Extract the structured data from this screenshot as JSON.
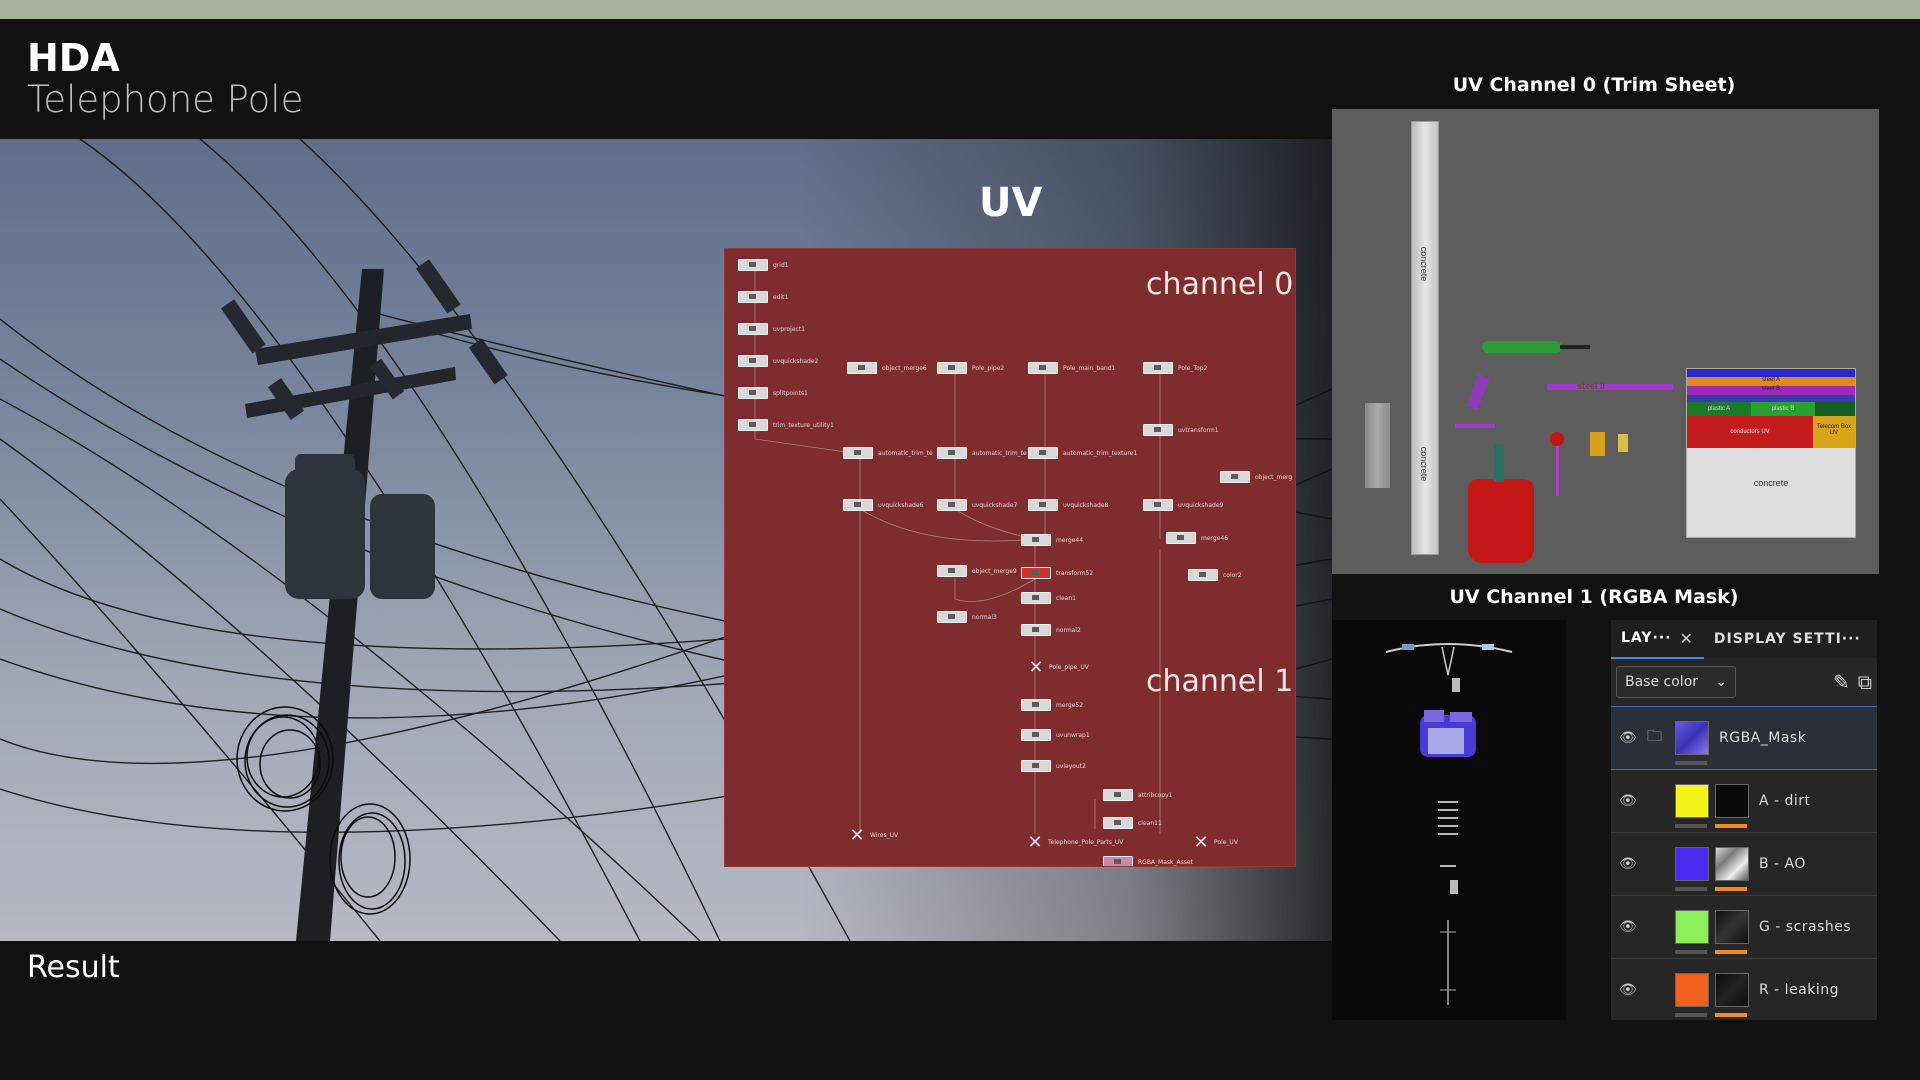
{
  "header": {
    "title": "HDA",
    "subtitle": "Telephone Pole"
  },
  "photo": {
    "caption": "Result"
  },
  "uv_section": {
    "heading": "UV",
    "channel0_label": "channel 0",
    "channel1_label": "channel 1",
    "nodes": [
      {
        "label": "grid1"
      },
      {
        "label": "edit1"
      },
      {
        "label": "uvproject1"
      },
      {
        "label": "uvquickshade2"
      },
      {
        "label": "splitpoints1"
      },
      {
        "label": "trim_texture_utility1"
      },
      {
        "label": "object_merge6"
      },
      {
        "label": "Pole_pipe2"
      },
      {
        "label": "Pole_main_band1"
      },
      {
        "label": "Pole_Top2"
      },
      {
        "label": "uvtransform1"
      },
      {
        "label": "object_merg"
      },
      {
        "label": "automatic_trim_te"
      },
      {
        "label": "automatic_trim_te"
      },
      {
        "label": "automatic_trim_texture1"
      },
      {
        "label": "uvquickshade6"
      },
      {
        "label": "uvquickshade7"
      },
      {
        "label": "uvquickshade8"
      },
      {
        "label": "uvquickshade9"
      },
      {
        "label": "merge44"
      },
      {
        "label": "merge46"
      },
      {
        "label": "object_merge9"
      },
      {
        "label": "transform52"
      },
      {
        "label": "color2"
      },
      {
        "label": "clean1"
      },
      {
        "label": "normal3"
      },
      {
        "label": "normal2"
      },
      {
        "label": "Pole_pipe_UV"
      },
      {
        "label": "merge52"
      },
      {
        "label": "uvunwrap1"
      },
      {
        "label": "uvlayout2"
      },
      {
        "label": "attribcopy1"
      },
      {
        "label": "clean11"
      },
      {
        "label": "Wires_UV"
      },
      {
        "label": "Telephone_Pole_Parts_UV"
      },
      {
        "label": "Pole_UV"
      },
      {
        "label": "RGBA_Mask_Asset"
      }
    ]
  },
  "trim_sheet": {
    "title": "UV Channel 0 (Trim Sheet)",
    "labels": {
      "concrete_top": "concrete",
      "concrete_bottom": "concrete",
      "steel_strip": "steel II",
      "steel_a": "steel A",
      "steel_b": "steel B",
      "plastic_a": "plastic A",
      "plastic_b": "plastic B",
      "conductors": "conductors UV",
      "telecom_box": "Telecom Box UV",
      "concrete_block": "concrete"
    }
  },
  "rgba_mask": {
    "title": "UV Channel 1 (RGBA Mask)"
  },
  "layers_panel": {
    "tabs": [
      {
        "label": "LAY···",
        "active": true
      },
      {
        "label": "DISPLAY SETTI···",
        "active": false
      }
    ],
    "channel_select": "Base color",
    "layers": [
      {
        "name": "RGBA_Mask",
        "color": "#5a4fd0",
        "is_folder": true,
        "selected": true
      },
      {
        "name": "A - dirt",
        "color": "#f5f51a",
        "is_folder": false,
        "selected": false
      },
      {
        "name": "B - AO",
        "color": "#4a2cf0",
        "is_folder": false,
        "selected": false
      },
      {
        "name": "G - scrashes",
        "color": "#8ef05a",
        "is_folder": false,
        "selected": false
      },
      {
        "name": "R - leaking",
        "color": "#f2601e",
        "is_folder": false,
        "selected": false
      }
    ]
  },
  "colors": {
    "topbar": "#a9b39a",
    "background": "#111111",
    "graph_bg": "#7f2c2e",
    "accent_blue": "#3d8ee6",
    "mask_bar": "#f08a24"
  }
}
